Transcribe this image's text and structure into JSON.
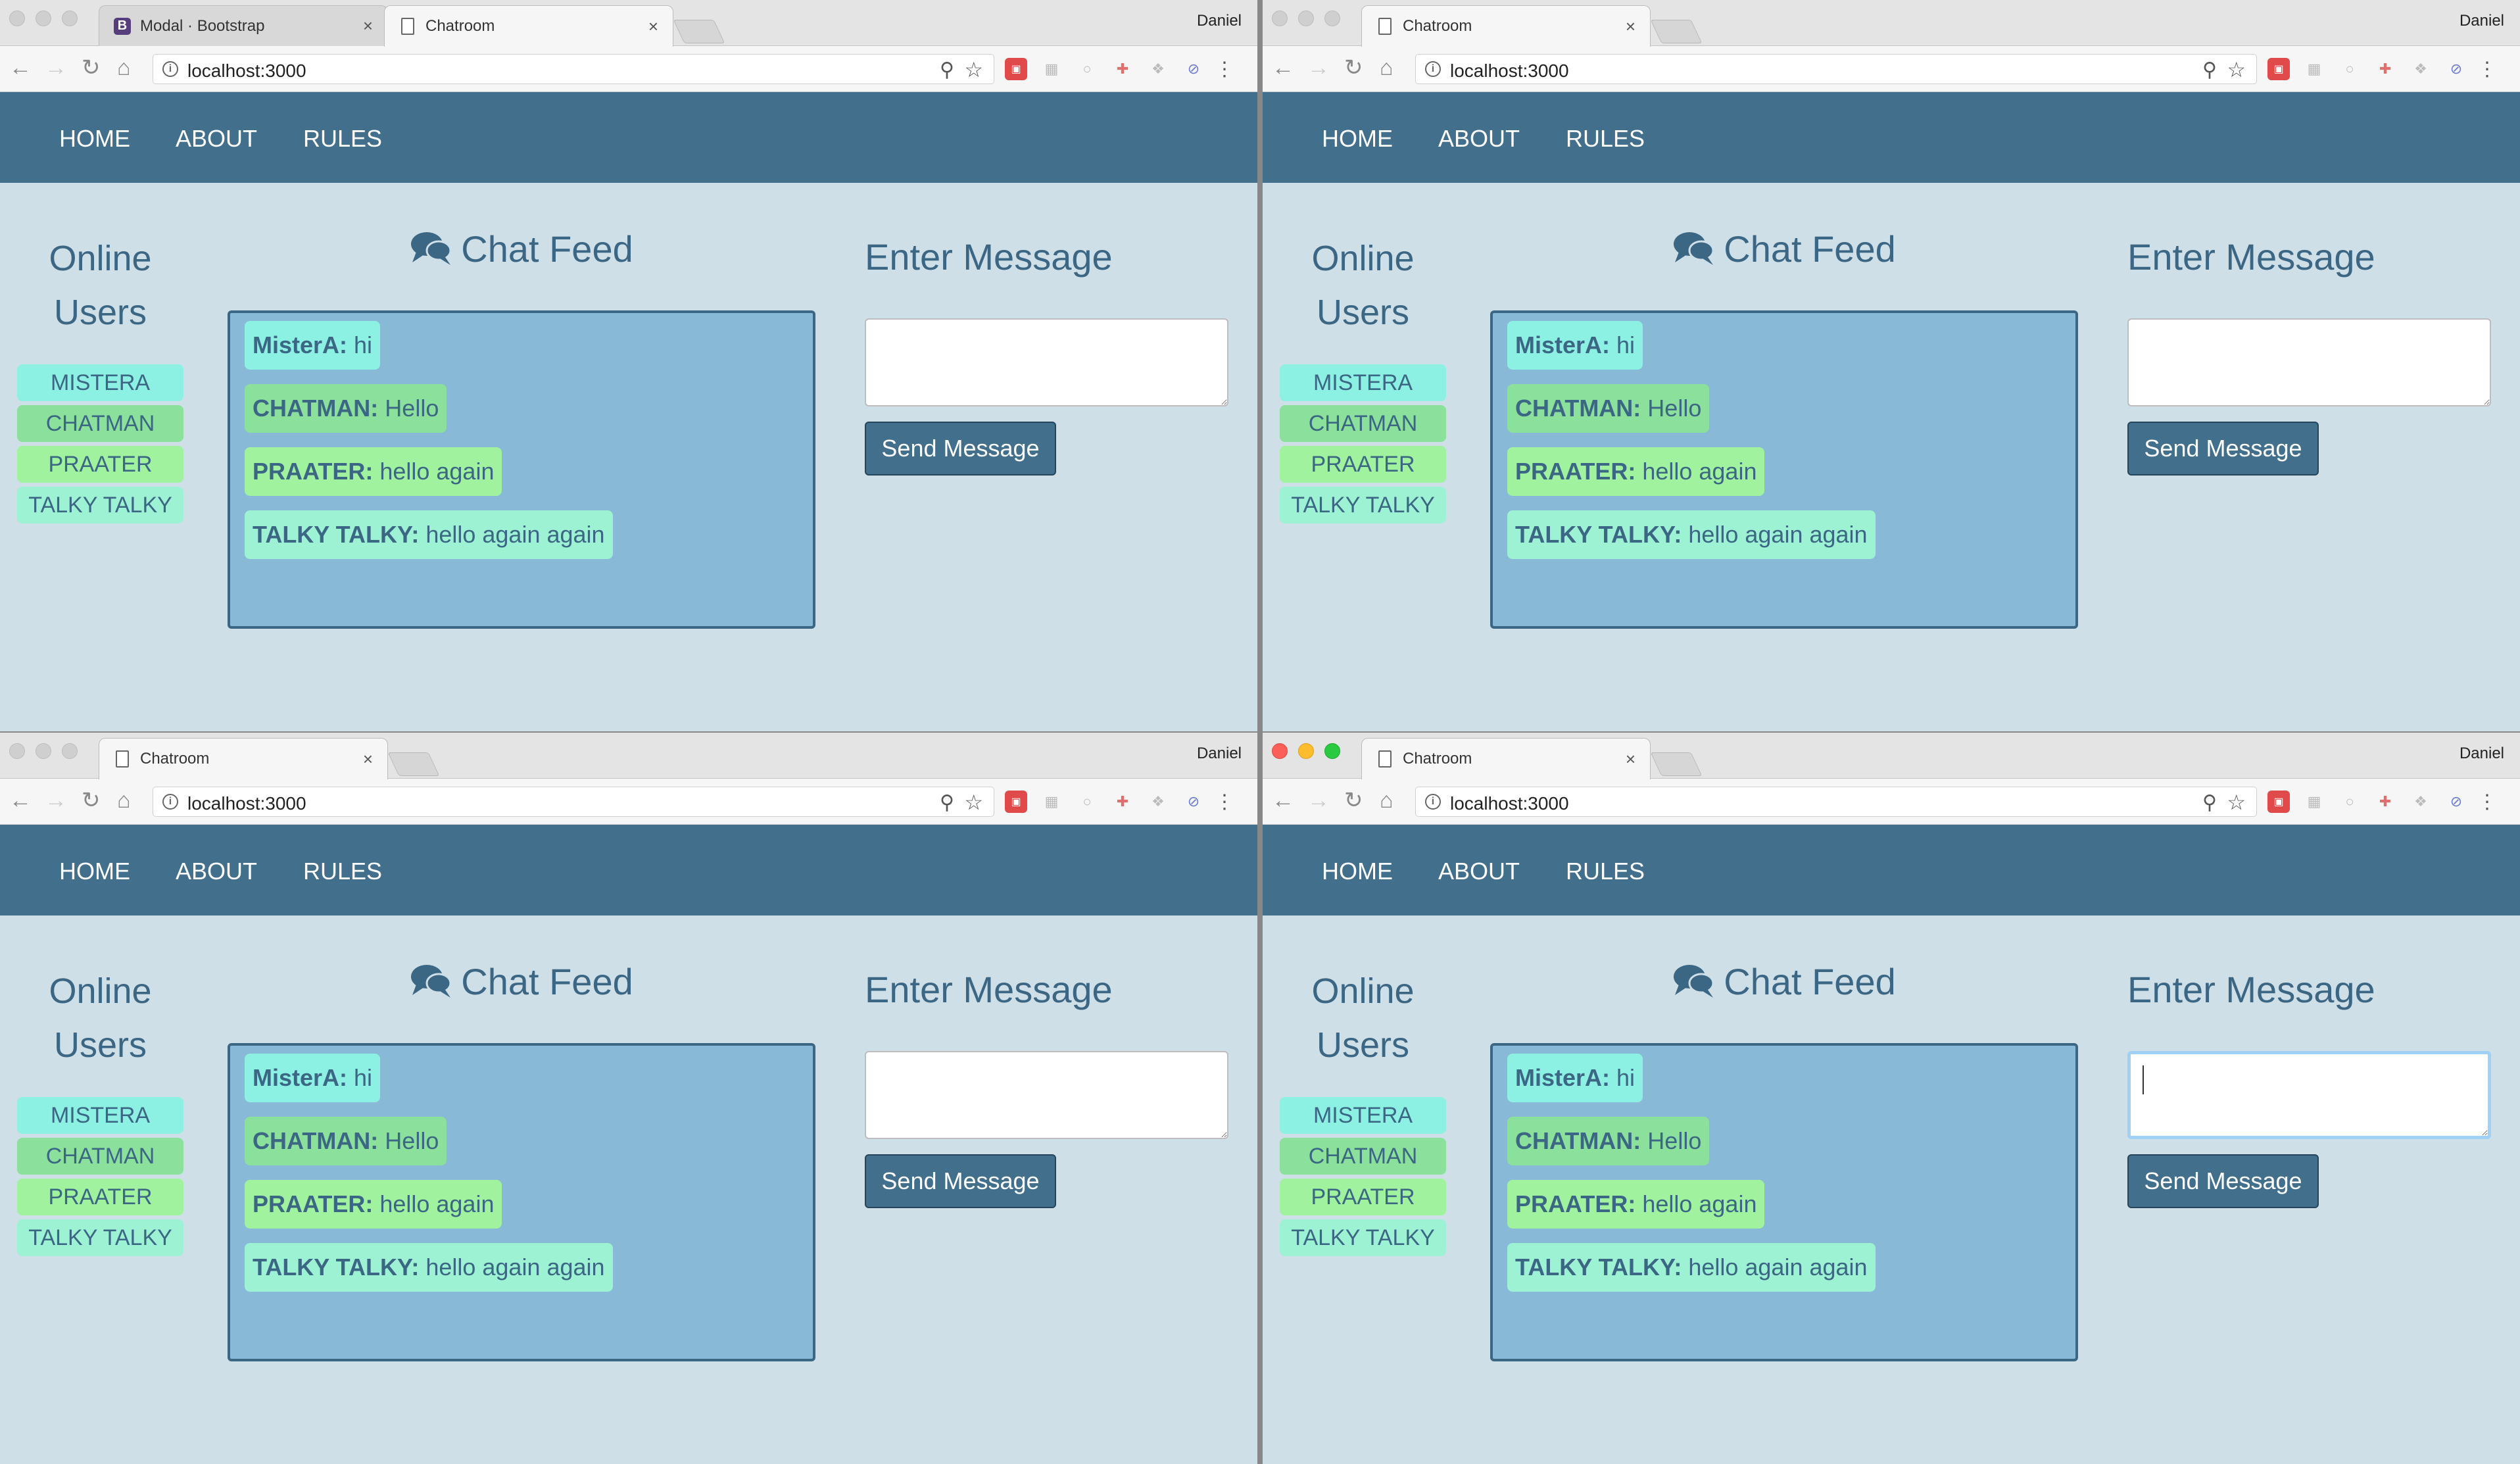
{
  "browser": {
    "profile_name": "Daniel",
    "url": "localhost:3000",
    "tabs_first": [
      {
        "title": "Modal · Bootstrap",
        "favicon": "bootstrap-icon"
      },
      {
        "title": "Chatroom",
        "favicon": "page-icon"
      }
    ],
    "tabs_other": [
      {
        "title": "Chatroom",
        "favicon": "page-icon"
      }
    ]
  },
  "nav": {
    "home": "HOME",
    "about": "ABOUT",
    "rules": "RULES"
  },
  "online": {
    "title_line1": "Online",
    "title_line2": "Users",
    "users": [
      "MISTERA",
      "CHATMAN",
      "PRAATER",
      "TALKY TALKY"
    ]
  },
  "feed": {
    "title": "Chat Feed",
    "messages": [
      {
        "user": "MisterA:",
        "text": " hi"
      },
      {
        "user": "CHATMAN:",
        "text": " Hello"
      },
      {
        "user": "PRAATER:",
        "text": " hello again"
      },
      {
        "user": "TALKY TALKY:",
        "text": " hello again again"
      }
    ]
  },
  "compose": {
    "title": "Enter Message",
    "input_value": "",
    "send_label": "Send Message"
  },
  "colors": {
    "navbar": "#416f8c",
    "page_bg": "#cfdfe8",
    "feed_bg": "#88b9d7",
    "text": "#3b6684",
    "user_colors": [
      "#8cf0e3",
      "#8be09c",
      "#a0f29e",
      "#9cf2d3"
    ]
  }
}
